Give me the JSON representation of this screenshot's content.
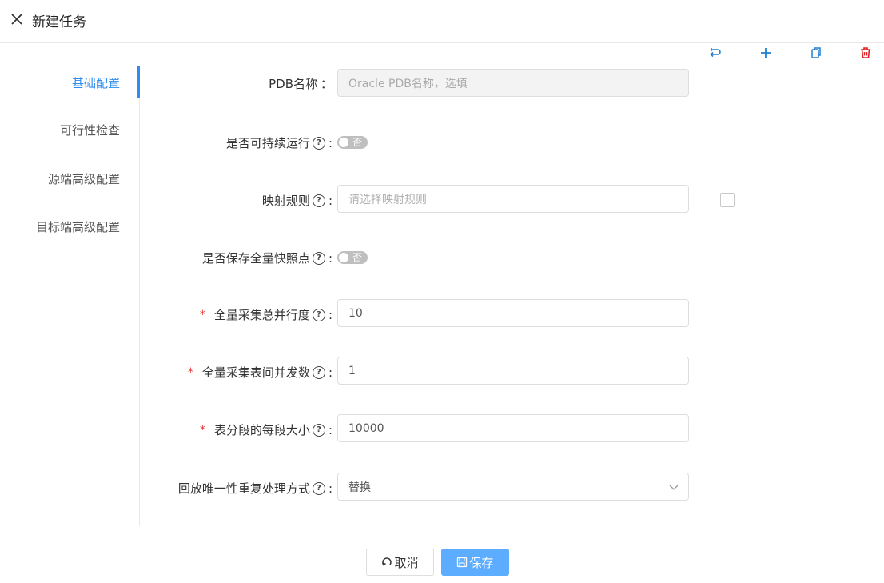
{
  "header": {
    "title": "新建任务"
  },
  "toolbar": {
    "colors": {
      "blue": "#1f7fd1",
      "red": "#e02424"
    },
    "icons": [
      "undo-icon",
      "plus-icon",
      "copy-icon",
      "trash-icon"
    ]
  },
  "sidebar": {
    "items": [
      {
        "label": "基础配置",
        "active": true
      },
      {
        "label": "可行性检查",
        "active": false
      },
      {
        "label": "源端高级配置",
        "active": false
      },
      {
        "label": "目标端高级配置",
        "active": false
      }
    ]
  },
  "form": {
    "pdb": {
      "label": "PDB名称",
      "colon": "：",
      "placeholder": "Oracle PDB名称，选填"
    },
    "continuous": {
      "label": "是否可持续运行",
      "colon": ":",
      "switch_text": "否",
      "on": false
    },
    "mapping": {
      "label": "映射规则",
      "colon": ":",
      "placeholder": "请选择映射规则"
    },
    "snapshot": {
      "label": "是否保存全量快照点",
      "colon": ":",
      "switch_text": "否",
      "on": false
    },
    "parallel": {
      "required_mark": "*",
      "label": "全量采集总并行度",
      "colon": ":",
      "value": "10"
    },
    "table_concurrency": {
      "required_mark": "*",
      "label": "全量采集表间并发数",
      "colon": ":",
      "value": "1"
    },
    "segment_size": {
      "required_mark": "*",
      "label": "表分段的每段大小",
      "colon": ":",
      "value": "10000"
    },
    "dup_handling": {
      "label": "回放唯一性重复处理方式",
      "colon": ":",
      "value": "替换"
    }
  },
  "footer": {
    "cancel_label": "取消",
    "save_label": "保存"
  },
  "colors": {
    "accent": "#2d8cf0",
    "save_button": "#5cadff",
    "required": "#e53935"
  }
}
